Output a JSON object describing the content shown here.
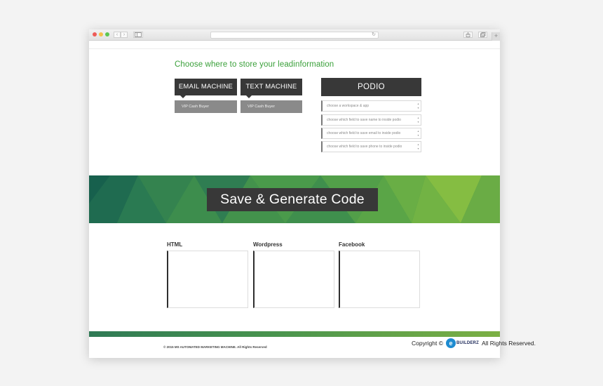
{
  "lead": {
    "heading": "Choose where to store your leadinformation",
    "email_button": "EMAIL MACHINE",
    "text_button": "TEXT MACHINE",
    "email_select_value": "VIP Cash Buyer",
    "text_select_value": "VIP Cash Buyer",
    "podio_button": "PODIO",
    "podio_fields": [
      "choose a workspace  & app",
      "choose which field to save name to inside podio",
      "choose which field to save email to inside podio",
      "choose which field to save phone to inside podio"
    ]
  },
  "banner": {
    "generate_button": "Save & Generate Code"
  },
  "code": {
    "labels": [
      "HTML",
      "Wordpress",
      "Facebook"
    ]
  },
  "footer": {
    "copyright_small": "© 2015 MS AUTOMATED MARKETING MACHINE. All Rights Reserved",
    "copyright_prefix": "Copyright ©",
    "logo_letter": "e",
    "logo_text": "BUILDERZ",
    "rights": "All Rights Reserved."
  },
  "icons": {
    "back": "‹",
    "forward": "›",
    "reload": "↻",
    "new_tab": "+",
    "spinner_up": "▴",
    "spinner_down": "▾"
  },
  "colors": {
    "accent_green": "#3aa03a",
    "button_dark": "#383838",
    "logo_blue": "#1e8bd0"
  }
}
